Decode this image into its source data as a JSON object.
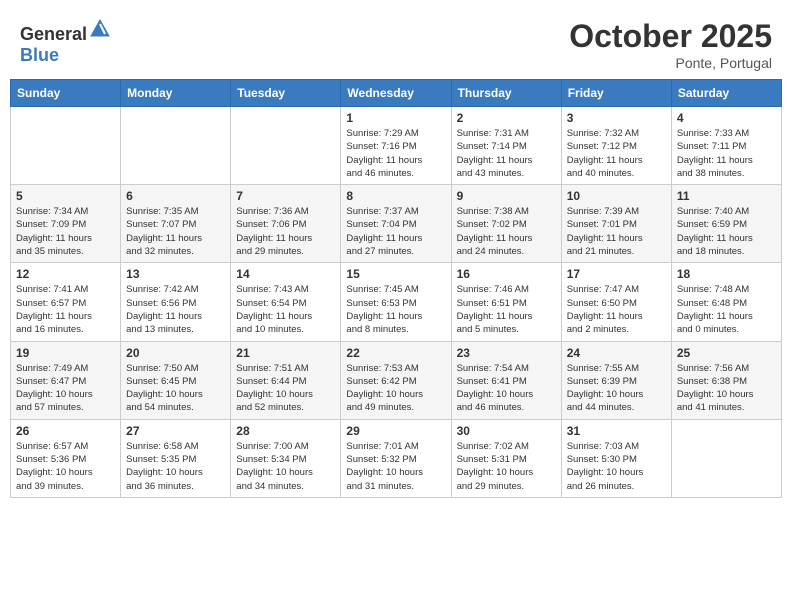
{
  "header": {
    "logo_general": "General",
    "logo_blue": "Blue",
    "month": "October 2025",
    "location": "Ponte, Portugal"
  },
  "days_of_week": [
    "Sunday",
    "Monday",
    "Tuesday",
    "Wednesday",
    "Thursday",
    "Friday",
    "Saturday"
  ],
  "weeks": [
    [
      {
        "day": "",
        "info": ""
      },
      {
        "day": "",
        "info": ""
      },
      {
        "day": "",
        "info": ""
      },
      {
        "day": "1",
        "info": "Sunrise: 7:29 AM\nSunset: 7:16 PM\nDaylight: 11 hours\nand 46 minutes."
      },
      {
        "day": "2",
        "info": "Sunrise: 7:31 AM\nSunset: 7:14 PM\nDaylight: 11 hours\nand 43 minutes."
      },
      {
        "day": "3",
        "info": "Sunrise: 7:32 AM\nSunset: 7:12 PM\nDaylight: 11 hours\nand 40 minutes."
      },
      {
        "day": "4",
        "info": "Sunrise: 7:33 AM\nSunset: 7:11 PM\nDaylight: 11 hours\nand 38 minutes."
      }
    ],
    [
      {
        "day": "5",
        "info": "Sunrise: 7:34 AM\nSunset: 7:09 PM\nDaylight: 11 hours\nand 35 minutes."
      },
      {
        "day": "6",
        "info": "Sunrise: 7:35 AM\nSunset: 7:07 PM\nDaylight: 11 hours\nand 32 minutes."
      },
      {
        "day": "7",
        "info": "Sunrise: 7:36 AM\nSunset: 7:06 PM\nDaylight: 11 hours\nand 29 minutes."
      },
      {
        "day": "8",
        "info": "Sunrise: 7:37 AM\nSunset: 7:04 PM\nDaylight: 11 hours\nand 27 minutes."
      },
      {
        "day": "9",
        "info": "Sunrise: 7:38 AM\nSunset: 7:02 PM\nDaylight: 11 hours\nand 24 minutes."
      },
      {
        "day": "10",
        "info": "Sunrise: 7:39 AM\nSunset: 7:01 PM\nDaylight: 11 hours\nand 21 minutes."
      },
      {
        "day": "11",
        "info": "Sunrise: 7:40 AM\nSunset: 6:59 PM\nDaylight: 11 hours\nand 18 minutes."
      }
    ],
    [
      {
        "day": "12",
        "info": "Sunrise: 7:41 AM\nSunset: 6:57 PM\nDaylight: 11 hours\nand 16 minutes."
      },
      {
        "day": "13",
        "info": "Sunrise: 7:42 AM\nSunset: 6:56 PM\nDaylight: 11 hours\nand 13 minutes."
      },
      {
        "day": "14",
        "info": "Sunrise: 7:43 AM\nSunset: 6:54 PM\nDaylight: 11 hours\nand 10 minutes."
      },
      {
        "day": "15",
        "info": "Sunrise: 7:45 AM\nSunset: 6:53 PM\nDaylight: 11 hours\nand 8 minutes."
      },
      {
        "day": "16",
        "info": "Sunrise: 7:46 AM\nSunset: 6:51 PM\nDaylight: 11 hours\nand 5 minutes."
      },
      {
        "day": "17",
        "info": "Sunrise: 7:47 AM\nSunset: 6:50 PM\nDaylight: 11 hours\nand 2 minutes."
      },
      {
        "day": "18",
        "info": "Sunrise: 7:48 AM\nSunset: 6:48 PM\nDaylight: 11 hours\nand 0 minutes."
      }
    ],
    [
      {
        "day": "19",
        "info": "Sunrise: 7:49 AM\nSunset: 6:47 PM\nDaylight: 10 hours\nand 57 minutes."
      },
      {
        "day": "20",
        "info": "Sunrise: 7:50 AM\nSunset: 6:45 PM\nDaylight: 10 hours\nand 54 minutes."
      },
      {
        "day": "21",
        "info": "Sunrise: 7:51 AM\nSunset: 6:44 PM\nDaylight: 10 hours\nand 52 minutes."
      },
      {
        "day": "22",
        "info": "Sunrise: 7:53 AM\nSunset: 6:42 PM\nDaylight: 10 hours\nand 49 minutes."
      },
      {
        "day": "23",
        "info": "Sunrise: 7:54 AM\nSunset: 6:41 PM\nDaylight: 10 hours\nand 46 minutes."
      },
      {
        "day": "24",
        "info": "Sunrise: 7:55 AM\nSunset: 6:39 PM\nDaylight: 10 hours\nand 44 minutes."
      },
      {
        "day": "25",
        "info": "Sunrise: 7:56 AM\nSunset: 6:38 PM\nDaylight: 10 hours\nand 41 minutes."
      }
    ],
    [
      {
        "day": "26",
        "info": "Sunrise: 6:57 AM\nSunset: 5:36 PM\nDaylight: 10 hours\nand 39 minutes."
      },
      {
        "day": "27",
        "info": "Sunrise: 6:58 AM\nSunset: 5:35 PM\nDaylight: 10 hours\nand 36 minutes."
      },
      {
        "day": "28",
        "info": "Sunrise: 7:00 AM\nSunset: 5:34 PM\nDaylight: 10 hours\nand 34 minutes."
      },
      {
        "day": "29",
        "info": "Sunrise: 7:01 AM\nSunset: 5:32 PM\nDaylight: 10 hours\nand 31 minutes."
      },
      {
        "day": "30",
        "info": "Sunrise: 7:02 AM\nSunset: 5:31 PM\nDaylight: 10 hours\nand 29 minutes."
      },
      {
        "day": "31",
        "info": "Sunrise: 7:03 AM\nSunset: 5:30 PM\nDaylight: 10 hours\nand 26 minutes."
      },
      {
        "day": "",
        "info": ""
      }
    ]
  ]
}
